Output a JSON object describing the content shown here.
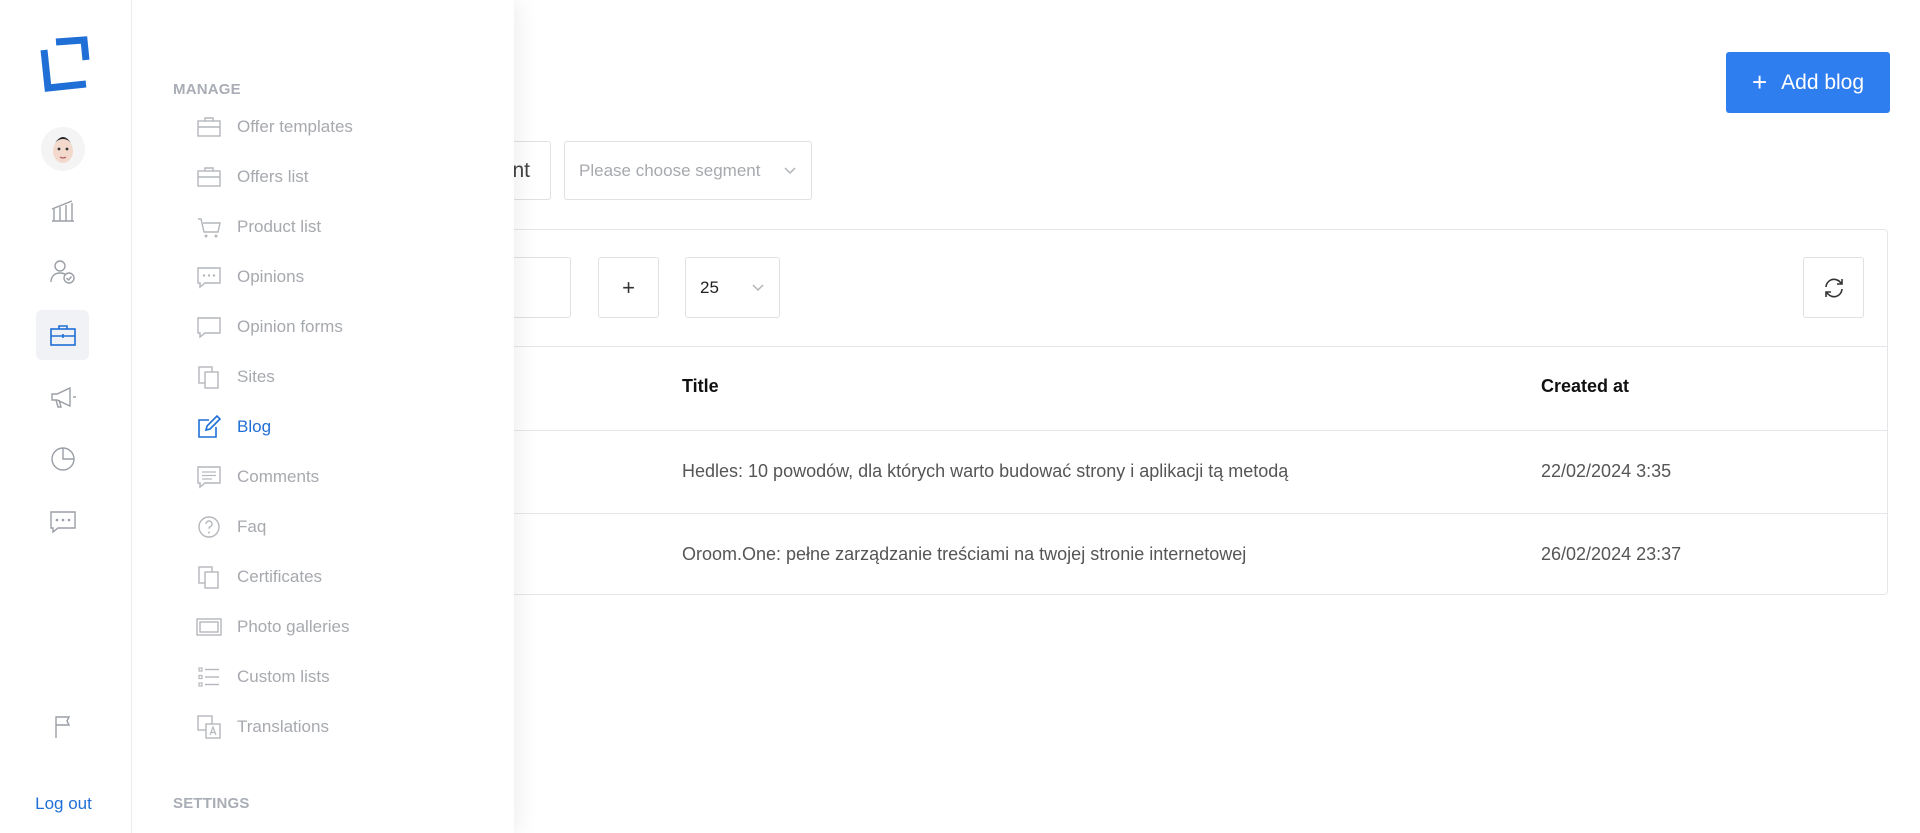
{
  "colors": {
    "accent": "#2f7ef0",
    "active_link": "#1f6fd6",
    "muted": "#a6a9ae"
  },
  "rail": {
    "logout_label": "Log out",
    "icons": [
      "logo-icon",
      "avatar",
      "bank-icon",
      "user-check-icon",
      "briefcase-icon",
      "megaphone-icon",
      "pie-chart-icon",
      "chat-icon",
      "flag-icon"
    ]
  },
  "menu": {
    "manage_label": "MANAGE",
    "settings_label": "SETTINGS",
    "items": [
      {
        "label": "Offer templates",
        "icon": "briefcase-icon"
      },
      {
        "label": "Offers list",
        "icon": "briefcase-icon"
      },
      {
        "label": "Product list",
        "icon": "cart-icon"
      },
      {
        "label": "Opinions",
        "icon": "chat-icon"
      },
      {
        "label": "Opinion forms",
        "icon": "chat-bubble-icon"
      },
      {
        "label": "Sites",
        "icon": "copy-icon"
      },
      {
        "label": "Blog",
        "icon": "edit-icon",
        "active": true
      },
      {
        "label": "Comments",
        "icon": "comment-icon"
      },
      {
        "label": "Faq",
        "icon": "question-icon"
      },
      {
        "label": "Certificates",
        "icon": "copy-icon"
      },
      {
        "label": "Photo galleries",
        "icon": "gallery-icon"
      },
      {
        "label": "Custom lists",
        "icon": "list-icon"
      },
      {
        "label": "Translations",
        "icon": "translate-icon"
      }
    ]
  },
  "header": {
    "add_button_label": "Add blog"
  },
  "filters": {
    "partial_text": "nt",
    "segment_placeholder": "Please choose segment"
  },
  "toolbar": {
    "add_symbol": "+",
    "per_page": "25"
  },
  "table": {
    "columns": [
      "Title",
      "Created at"
    ],
    "rows": [
      {
        "title": "Hedles: 10 powodów, dla których warto budować strony i aplikacji tą metodą",
        "created": "22/02/2024 3:35"
      },
      {
        "title": "Oroom.One: pełne zarządzanie treściami na twojej stronie internetowej",
        "created": "26/02/2024 23:37"
      }
    ]
  }
}
